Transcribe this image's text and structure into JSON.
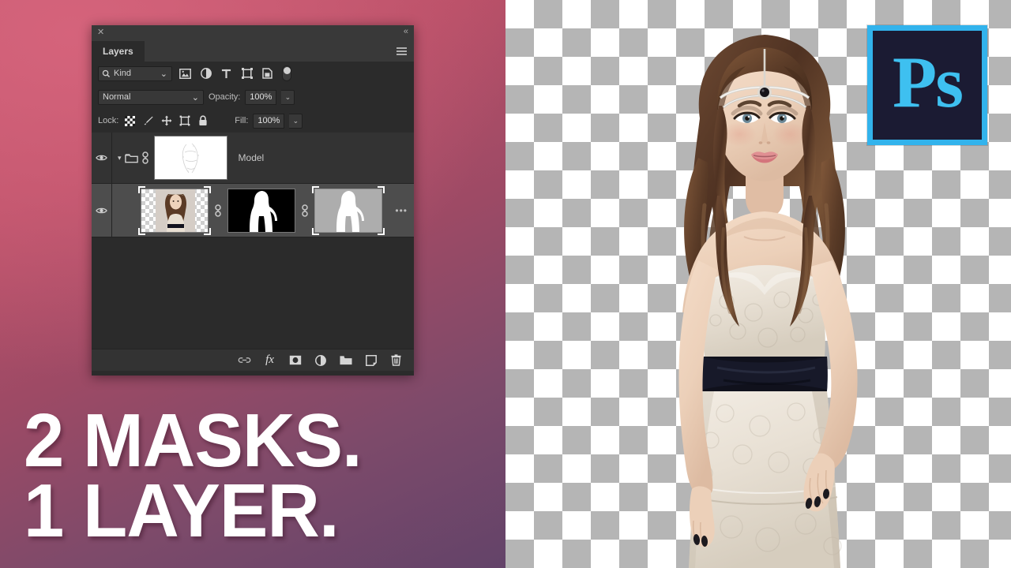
{
  "background": {
    "gradient_from": "#c4586f",
    "gradient_to": "#634369",
    "checker_light": "#ffffff",
    "checker_dark": "#b5b5b5",
    "checker_size_px": 36
  },
  "headline": {
    "line1": "2 MASKS.",
    "line2": "1 LAYER.",
    "color": "#ffffff"
  },
  "logo": {
    "name": "Ps",
    "border_color": "#32b3ec",
    "fill_color": "#1b1b33",
    "text_color": "#3ec0f0"
  },
  "panel": {
    "title_close": "✕",
    "collapse": "«",
    "tab_label": "Layers",
    "menu_icon": "hamburger-icon",
    "filter": {
      "search_icon": "search-icon",
      "kind_label": "Kind",
      "caret": "⌄",
      "icons": [
        "pixel-layer-filter-icon",
        "adjustment-layer-filter-icon",
        "type-layer-filter-icon",
        "shape-layer-filter-icon",
        "smart-object-filter-icon"
      ],
      "toggle": "filter-enable-toggle"
    },
    "blend": {
      "mode": "Normal",
      "caret": "⌄",
      "opacity_label": "Opacity:",
      "opacity_value": "100%",
      "stepper": "⌄"
    },
    "lock": {
      "label": "Lock:",
      "icons": [
        "lock-transparent-pixels-icon",
        "lock-image-pixels-icon",
        "lock-position-icon",
        "lock-artboard-nesting-icon",
        "lock-all-icon"
      ],
      "fill_label": "Fill:",
      "fill_value": "100%",
      "stepper": "⌄"
    },
    "layers": [
      {
        "type": "group",
        "visible": true,
        "visibility_icon": "eye-icon",
        "expand_icon": "chevron-down-icon",
        "group_icon": "folder-icon",
        "link_icon": "link-icon",
        "name": "Model",
        "thumbnail": "white-group-mask-thumbnail",
        "selected": false
      },
      {
        "type": "layer",
        "visible": true,
        "visibility_icon": "eye-icon",
        "name": "",
        "selected": true,
        "thumbnails": [
          "layer-image-thumbnail",
          "layer-mask-thumbnail",
          "vector-mask-thumbnail"
        ],
        "link_icon": "link-icon",
        "overflow": "•••"
      }
    ],
    "footer_icons": [
      "link-layers-icon",
      "layer-style-fx-icon",
      "add-layer-mask-icon",
      "new-adjustment-layer-icon",
      "new-group-icon",
      "new-layer-icon",
      "delete-layer-icon"
    ],
    "footer_labels": {
      "fx": "fx"
    }
  }
}
